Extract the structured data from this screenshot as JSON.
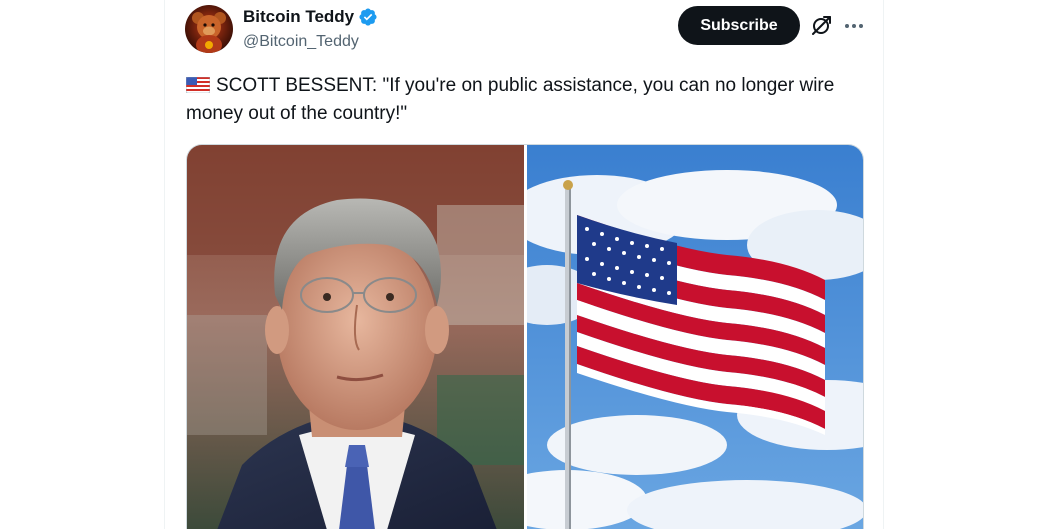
{
  "author": {
    "display_name": "Bitcoin Teddy",
    "handle": "@Bitcoin_Teddy",
    "avatar_icon": "teddy-bear-avatar",
    "verified": true,
    "verified_color": "#1d9bf0"
  },
  "actions": {
    "subscribe_label": "Subscribe",
    "grok_icon": "grok-icon",
    "more_icon": "more-icon"
  },
  "post": {
    "flag_emoji": "us-flag-emoji",
    "text": "SCOTT BESSENT: \"If you're on public assistance, you can no longer wire money out of the country!\""
  },
  "media": {
    "images": [
      "portrait-photo",
      "american-flag-photo"
    ]
  },
  "colors": {
    "text": "#0f1419",
    "secondary_text": "#536471",
    "button_bg": "#0f1419",
    "border": "#cfd9de"
  }
}
